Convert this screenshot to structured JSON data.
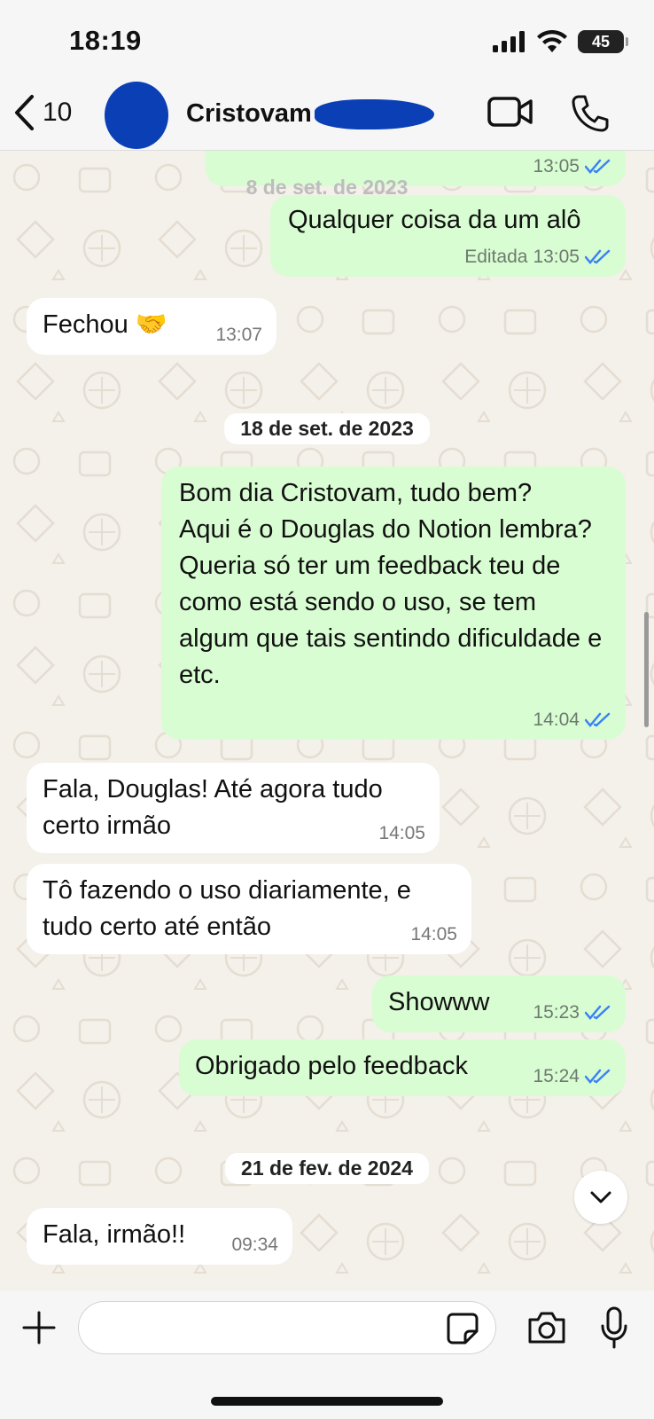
{
  "status_bar": {
    "time": "18:19",
    "battery": "45"
  },
  "header": {
    "back_count": "10",
    "contact_name": "Cristovam"
  },
  "colors": {
    "outgoing_bubble": "#d9fdd3",
    "incoming_bubble": "#ffffff",
    "read_ticks": "#3b82f6",
    "redaction": "#0a3fb5"
  },
  "chat": {
    "messages": [
      {
        "direction": "out",
        "text": "",
        "time": "13:05",
        "edited": "",
        "status": "read"
      },
      {
        "direction": "out",
        "text": "Qualquer coisa da um alô",
        "time": "13:05",
        "edited": "Editada",
        "status": "read"
      },
      {
        "direction": "in",
        "text": "Fechou 🤝",
        "time": "13:07"
      },
      {
        "direction": "out",
        "text": "Bom dia Cristovam, tudo bem?\nAqui é o Douglas do Notion lembra?\nQueria só ter um feedback teu de como está sendo o uso, se tem algum que tais sentindo dificuldade e etc.",
        "time": "14:04",
        "status": "read"
      },
      {
        "direction": "in",
        "text": "Fala, Douglas! Até agora tudo certo irmão",
        "time": "14:05"
      },
      {
        "direction": "in",
        "text": "Tô fazendo o uso diariamente, e tudo certo até então",
        "time": "14:05"
      },
      {
        "direction": "out",
        "text": "Showww",
        "time": "15:23",
        "status": "read"
      },
      {
        "direction": "out",
        "text": "Obrigado pelo feedback",
        "time": "15:24",
        "status": "read"
      },
      {
        "direction": "in",
        "text": "Fala, irmão!!",
        "time": "09:34"
      }
    ],
    "date_separators": [
      "8 de set. de 2023",
      "18 de set. de 2023",
      "21 de fev. de 2024"
    ]
  },
  "icons": {
    "back": "chevron-left-icon",
    "video": "video-call-icon",
    "phone": "phone-icon",
    "plus": "plus-icon",
    "sticker": "sticker-icon",
    "camera": "camera-icon",
    "mic": "microphone-icon",
    "scroll_down": "chevron-down-icon",
    "read": "double-check-icon"
  }
}
